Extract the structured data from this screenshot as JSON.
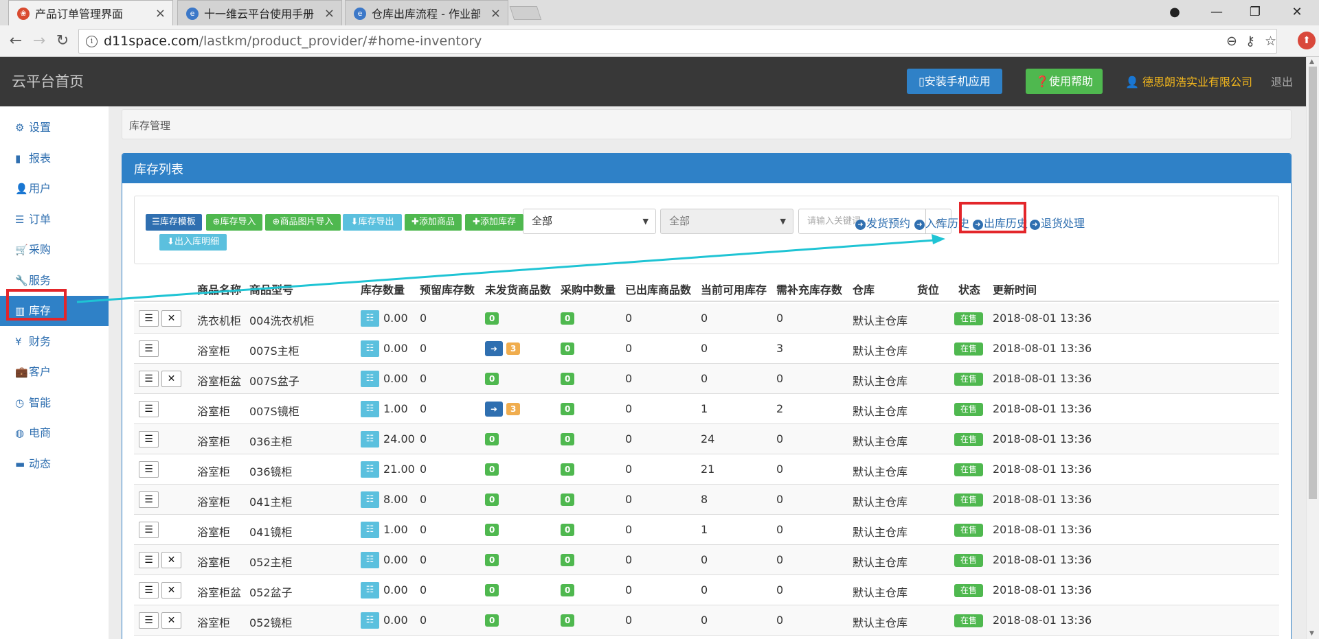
{
  "browser": {
    "tabs": [
      {
        "title": "产品订单管理界面",
        "active": true
      },
      {
        "title": "十一维云平台使用手册 -",
        "active": false
      },
      {
        "title": "仓库出库流程 - 作业部落",
        "active": false
      }
    ],
    "url_host": "d11space.com",
    "url_path": "/lastkm/product_provider/#home-inventory"
  },
  "header": {
    "brand": "云平台首页",
    "install_app": "安装手机应用",
    "help": "使用帮助",
    "company": "德思朗浩实业有限公司",
    "logout": "退出"
  },
  "sidebar": {
    "items": [
      {
        "label": "设置",
        "icon": "gear-icon",
        "glyph": "⚙"
      },
      {
        "label": "报表",
        "icon": "bar-chart-icon",
        "glyph": "▮"
      },
      {
        "label": "用户",
        "icon": "user-icon",
        "glyph": "👤"
      },
      {
        "label": "订单",
        "icon": "document-icon",
        "glyph": "☰"
      },
      {
        "label": "采购",
        "icon": "cart-icon",
        "glyph": "🛒"
      },
      {
        "label": "服务",
        "icon": "wrench-icon",
        "glyph": "🔧"
      },
      {
        "label": "库存",
        "icon": "barcode-icon",
        "glyph": "▥"
      },
      {
        "label": "财务",
        "icon": "yen-icon",
        "glyph": "¥"
      },
      {
        "label": "客户",
        "icon": "briefcase-icon",
        "glyph": "💼"
      },
      {
        "label": "智能",
        "icon": "clock-icon",
        "glyph": "◷"
      },
      {
        "label": "电商",
        "icon": "globe-icon",
        "glyph": "◍"
      },
      {
        "label": "动态",
        "icon": "comment-icon",
        "glyph": "▬"
      }
    ]
  },
  "breadcrumb": "库存管理",
  "panel": {
    "title": "库存列表",
    "buttons": [
      {
        "label": "库存模板",
        "color": "navy"
      },
      {
        "label": "库存导入",
        "color": "green"
      },
      {
        "label": "商品图片导入",
        "color": "green"
      },
      {
        "label": "库存导出",
        "color": "cyan"
      },
      {
        "label": "添加商品",
        "color": "green"
      },
      {
        "label": "添加库存",
        "color": "green"
      },
      {
        "label": "出入库明细",
        "color": "cyan"
      }
    ],
    "select1": "全部",
    "select2": "全部",
    "search_placeholder": "请输入关键词...",
    "links": [
      "发货预约",
      "入库历史",
      "出库历史",
      "退货处理"
    ]
  },
  "table": {
    "columns": [
      "商品名称",
      "商品型号",
      "库存数量",
      "预留库存数",
      "未发货商品数",
      "采购中数量",
      "已出库商品数",
      "当前可用库存",
      "需补充库存数",
      "仓库",
      "货位",
      "状态",
      "更新时间"
    ],
    "rows": [
      {
        "name": "洗衣机柜",
        "model": "004洗衣机柜",
        "qty": "0.00",
        "reserved": "0",
        "unshipped": "0",
        "unshipped_link": false,
        "purchasing": "0",
        "shipped": "0",
        "available": "0",
        "replenish": "0",
        "warehouse": "默认主仓库",
        "location": "",
        "status": "在售",
        "updated": "2018-08-01 13:36",
        "deletable": true
      },
      {
        "name": "浴室柜",
        "model": "007S主柜",
        "qty": "0.00",
        "reserved": "0",
        "unshipped": "3",
        "unshipped_link": true,
        "purchasing": "0",
        "shipped": "0",
        "available": "0",
        "replenish": "3",
        "warehouse": "默认主仓库",
        "location": "",
        "status": "在售",
        "updated": "2018-08-01 13:36",
        "deletable": false
      },
      {
        "name": "浴室柜盆",
        "model": "007S盆子",
        "qty": "0.00",
        "reserved": "0",
        "unshipped": "0",
        "unshipped_link": false,
        "purchasing": "0",
        "shipped": "0",
        "available": "0",
        "replenish": "0",
        "warehouse": "默认主仓库",
        "location": "",
        "status": "在售",
        "updated": "2018-08-01 13:36",
        "deletable": true
      },
      {
        "name": "浴室柜",
        "model": "007S镜柜",
        "qty": "1.00",
        "reserved": "0",
        "unshipped": "3",
        "unshipped_link": true,
        "purchasing": "0",
        "shipped": "0",
        "available": "1",
        "replenish": "2",
        "warehouse": "默认主仓库",
        "location": "",
        "status": "在售",
        "updated": "2018-08-01 13:36",
        "deletable": false
      },
      {
        "name": "浴室柜",
        "model": "036主柜",
        "qty": "24.00",
        "reserved": "0",
        "unshipped": "0",
        "unshipped_link": false,
        "purchasing": "0",
        "shipped": "0",
        "available": "24",
        "replenish": "0",
        "warehouse": "默认主仓库",
        "location": "",
        "status": "在售",
        "updated": "2018-08-01 13:36",
        "deletable": false
      },
      {
        "name": "浴室柜",
        "model": "036镜柜",
        "qty": "21.00",
        "reserved": "0",
        "unshipped": "0",
        "unshipped_link": false,
        "purchasing": "0",
        "shipped": "0",
        "available": "21",
        "replenish": "0",
        "warehouse": "默认主仓库",
        "location": "",
        "status": "在售",
        "updated": "2018-08-01 13:36",
        "deletable": false
      },
      {
        "name": "浴室柜",
        "model": "041主柜",
        "qty": "8.00",
        "reserved": "0",
        "unshipped": "0",
        "unshipped_link": false,
        "purchasing": "0",
        "shipped": "0",
        "available": "8",
        "replenish": "0",
        "warehouse": "默认主仓库",
        "location": "",
        "status": "在售",
        "updated": "2018-08-01 13:36",
        "deletable": false
      },
      {
        "name": "浴室柜",
        "model": "041镜柜",
        "qty": "1.00",
        "reserved": "0",
        "unshipped": "0",
        "unshipped_link": false,
        "purchasing": "0",
        "shipped": "0",
        "available": "1",
        "replenish": "0",
        "warehouse": "默认主仓库",
        "location": "",
        "status": "在售",
        "updated": "2018-08-01 13:36",
        "deletable": false
      },
      {
        "name": "浴室柜",
        "model": "052主柜",
        "qty": "0.00",
        "reserved": "0",
        "unshipped": "0",
        "unshipped_link": false,
        "purchasing": "0",
        "shipped": "0",
        "available": "0",
        "replenish": "0",
        "warehouse": "默认主仓库",
        "location": "",
        "status": "在售",
        "updated": "2018-08-01 13:36",
        "deletable": true
      },
      {
        "name": "浴室柜盆",
        "model": "052盆子",
        "qty": "0.00",
        "reserved": "0",
        "unshipped": "0",
        "unshipped_link": false,
        "purchasing": "0",
        "shipped": "0",
        "available": "0",
        "replenish": "0",
        "warehouse": "默认主仓库",
        "location": "",
        "status": "在售",
        "updated": "2018-08-01 13:36",
        "deletable": true
      },
      {
        "name": "浴室柜",
        "model": "052镜柜",
        "qty": "0.00",
        "reserved": "0",
        "unshipped": "0",
        "unshipped_link": false,
        "purchasing": "0",
        "shipped": "0",
        "available": "0",
        "replenish": "0",
        "warehouse": "默认主仓库",
        "location": "",
        "status": "在售",
        "updated": "2018-08-01 13:36",
        "deletable": true
      }
    ]
  },
  "colors": {
    "primary": "#2f81c7",
    "success": "#4fb84f",
    "info": "#5bc0de",
    "warning": "#f0ad4e",
    "annotation_red": "#e3262a",
    "annotation_arrow": "#1fc4d4",
    "company": "#f5b81c"
  }
}
